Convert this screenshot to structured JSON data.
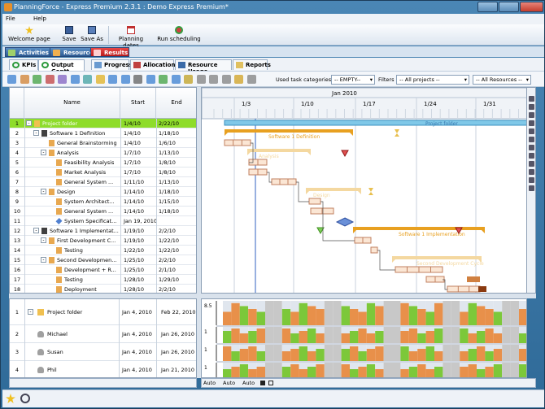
{
  "window": {
    "title": "PlanningForce - Express Premium 2.3.1 : Demo Express Premium*"
  },
  "menu": [
    "File",
    "Help"
  ],
  "toolbar": [
    {
      "label": "Welcome page",
      "icon": "star-icon"
    },
    {
      "label": "Save",
      "icon": "save-icon"
    },
    {
      "label": "Save As",
      "icon": "save-as-icon"
    },
    {
      "label": "Planning dates",
      "icon": "calendar-icon"
    },
    {
      "label": "Run scheduling",
      "icon": "run-icon"
    }
  ],
  "main_tabs": [
    {
      "label": "Activities",
      "color": "#2f5d95"
    },
    {
      "label": "Resources",
      "color": "#2f5d95"
    },
    {
      "label": "Results",
      "color": "#c62222"
    }
  ],
  "sub_tabs": [
    {
      "label": "KPIs"
    },
    {
      "label": "Output Gantt"
    },
    {
      "label": "Progress"
    },
    {
      "label": "Allocations"
    },
    {
      "label": "Resource Usage"
    },
    {
      "label": "Reports"
    }
  ],
  "filters": {
    "categories_label": "Used task categories :",
    "categories_value": "-- EMPTY--",
    "filters_label": "Filters",
    "projects_value": "-- All projects --",
    "resources_value": "-- All Resources --"
  },
  "grid": {
    "headers": {
      "name": "Name",
      "start": "Start",
      "end": "End"
    },
    "rows": [
      {
        "n": "1",
        "name": "Project folder",
        "start": "1/4/10",
        "end": "2/22/10",
        "level": 0,
        "type": "folder",
        "expand": "-"
      },
      {
        "n": "2",
        "name": "Software 1 Definition",
        "start": "1/4/10",
        "end": "1/18/10",
        "level": 1,
        "type": "summary",
        "expand": "-"
      },
      {
        "n": "3",
        "name": "General Brainstorming",
        "start": "1/4/10",
        "end": "1/6/10",
        "level": 2,
        "type": "task",
        "expand": ""
      },
      {
        "n": "4",
        "name": "Analysis",
        "start": "1/7/10",
        "end": "1/13/10",
        "level": 2,
        "type": "task",
        "expand": "-"
      },
      {
        "n": "5",
        "name": "Feasibility Analysis",
        "start": "1/7/10",
        "end": "1/8/10",
        "level": 3,
        "type": "task",
        "expand": ""
      },
      {
        "n": "6",
        "name": "Market Analysis",
        "start": "1/7/10",
        "end": "1/8/10",
        "level": 3,
        "type": "task",
        "expand": ""
      },
      {
        "n": "7",
        "name": "General System ...",
        "start": "1/11/10",
        "end": "1/13/10",
        "level": 3,
        "type": "task",
        "expand": ""
      },
      {
        "n": "8",
        "name": "Design",
        "start": "1/14/10",
        "end": "1/18/10",
        "level": 2,
        "type": "task",
        "expand": "-"
      },
      {
        "n": "9",
        "name": "System Architect...",
        "start": "1/14/10",
        "end": "1/15/10",
        "level": 3,
        "type": "task",
        "expand": ""
      },
      {
        "n": "10",
        "name": "General System ...",
        "start": "1/14/10",
        "end": "1/18/10",
        "level": 3,
        "type": "task",
        "expand": ""
      },
      {
        "n": "11",
        "name": "System Specificat...",
        "start": "Jan 19, 2010",
        "end": "",
        "level": 3,
        "type": "milestone",
        "expand": ""
      },
      {
        "n": "12",
        "name": "Software 1 Implementat...",
        "start": "1/19/10",
        "end": "2/2/10",
        "level": 1,
        "type": "summary",
        "expand": "-"
      },
      {
        "n": "13",
        "name": "First Development C...",
        "start": "1/19/10",
        "end": "1/22/10",
        "level": 2,
        "type": "task",
        "expand": "-"
      },
      {
        "n": "14",
        "name": "Testing",
        "start": "1/22/10",
        "end": "1/22/10",
        "level": 3,
        "type": "task",
        "expand": ""
      },
      {
        "n": "15",
        "name": "Second Developmen...",
        "start": "1/25/10",
        "end": "2/2/10",
        "level": 2,
        "type": "task",
        "expand": "-"
      },
      {
        "n": "16",
        "name": "Development + R...",
        "start": "1/25/10",
        "end": "2/1/10",
        "level": 3,
        "type": "task",
        "expand": ""
      },
      {
        "n": "17",
        "name": "Testing",
        "start": "1/28/10",
        "end": "1/29/10",
        "level": 3,
        "type": "task",
        "expand": ""
      },
      {
        "n": "18",
        "name": "Deployment",
        "start": "1/28/10",
        "end": "2/2/10",
        "level": 3,
        "type": "task",
        "expand": ""
      }
    ]
  },
  "gantt": {
    "month": "Jan 2010",
    "weeks": [
      "1/3",
      "1/10",
      "1/17",
      "1/24",
      "1/31"
    ],
    "bar_labels": {
      "project": "Project folder",
      "sw1def": "Software 1 Definition",
      "analysis": "Analysis",
      "design": "Design",
      "sw1impl": "Software 1 Implementation",
      "second": "Second Development Cycle"
    }
  },
  "resources": {
    "rows": [
      {
        "n": "1",
        "name": "Project folder",
        "start": "Jan 4, 2010",
        "end": "Feb 22, 2010",
        "type": "folder"
      },
      {
        "n": "2",
        "name": "Michael",
        "start": "Jan 4, 2010",
        "end": "Jan 26, 2010",
        "type": "person"
      },
      {
        "n": "3",
        "name": "Susan",
        "start": "Jan 4, 2010",
        "end": "Jan 26, 2010",
        "type": "person"
      },
      {
        "n": "4",
        "name": "Phil",
        "start": "Jan 4, 2010",
        "end": "Jan 21, 2010",
        "type": "person"
      }
    ],
    "axis_labels": [
      "8.5",
      "1",
      "1",
      "1"
    ],
    "zoom": [
      "Auto",
      "Auto",
      "Auto"
    ]
  }
}
